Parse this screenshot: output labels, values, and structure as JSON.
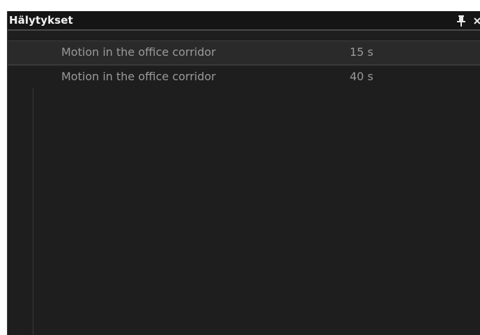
{
  "panel": {
    "title": "Hälytykset",
    "pin_icon": "pin-icon",
    "close_icon": "close-icon"
  },
  "alarms": [
    {
      "description": "Motion in the office corridor",
      "time": "15 s"
    },
    {
      "description": "Motion in the office corridor",
      "time": "40 s"
    }
  ],
  "colors": {
    "panel_bg": "#1e1e1e",
    "title_bg": "#151515",
    "selected_row_bg": "#2a2a2a",
    "text": "#9a9a9a",
    "title_text": "#f2f2f2"
  }
}
